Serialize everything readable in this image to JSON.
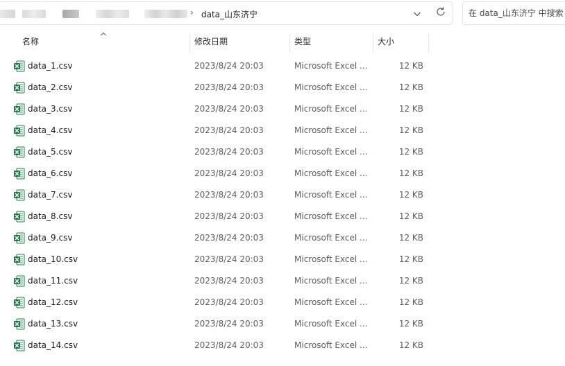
{
  "address": {
    "current_folder": "data_山东济宁",
    "separator": "›"
  },
  "search": {
    "placeholder": "在 data_山东济宁 中搜索"
  },
  "columns": {
    "name": "名称",
    "date": "修改日期",
    "type": "类型",
    "size": "大小"
  },
  "files": [
    {
      "name": "data_1.csv",
      "date": "2023/8/24 20:03",
      "type": "Microsoft Excel ...",
      "size": "12 KB"
    },
    {
      "name": "data_2.csv",
      "date": "2023/8/24 20:03",
      "type": "Microsoft Excel ...",
      "size": "12 KB"
    },
    {
      "name": "data_3.csv",
      "date": "2023/8/24 20:03",
      "type": "Microsoft Excel ...",
      "size": "12 KB"
    },
    {
      "name": "data_4.csv",
      "date": "2023/8/24 20:03",
      "type": "Microsoft Excel ...",
      "size": "12 KB"
    },
    {
      "name": "data_5.csv",
      "date": "2023/8/24 20:03",
      "type": "Microsoft Excel ...",
      "size": "12 KB"
    },
    {
      "name": "data_6.csv",
      "date": "2023/8/24 20:03",
      "type": "Microsoft Excel ...",
      "size": "12 KB"
    },
    {
      "name": "data_7.csv",
      "date": "2023/8/24 20:03",
      "type": "Microsoft Excel ...",
      "size": "12 KB"
    },
    {
      "name": "data_8.csv",
      "date": "2023/8/24 20:03",
      "type": "Microsoft Excel ...",
      "size": "12 KB"
    },
    {
      "name": "data_9.csv",
      "date": "2023/8/24 20:03",
      "type": "Microsoft Excel ...",
      "size": "12 KB"
    },
    {
      "name": "data_10.csv",
      "date": "2023/8/24 20:03",
      "type": "Microsoft Excel ...",
      "size": "12 KB"
    },
    {
      "name": "data_11.csv",
      "date": "2023/8/24 20:03",
      "type": "Microsoft Excel ...",
      "size": "12 KB"
    },
    {
      "name": "data_12.csv",
      "date": "2023/8/24 20:03",
      "type": "Microsoft Excel ...",
      "size": "12 KB"
    },
    {
      "name": "data_13.csv",
      "date": "2023/8/24 20:03",
      "type": "Microsoft Excel ...",
      "size": "12 KB"
    },
    {
      "name": "data_14.csv",
      "date": "2023/8/24 20:03",
      "type": "Microsoft Excel ...",
      "size": "12 KB"
    }
  ],
  "icons": {
    "file": "excel-csv-icon",
    "sort": "sort-ascending-icon",
    "dropdown": "chevron-down-icon",
    "refresh": "refresh-icon"
  },
  "colors": {
    "excel_green": "#1d7a43",
    "excel_green_light": "#21a366"
  }
}
